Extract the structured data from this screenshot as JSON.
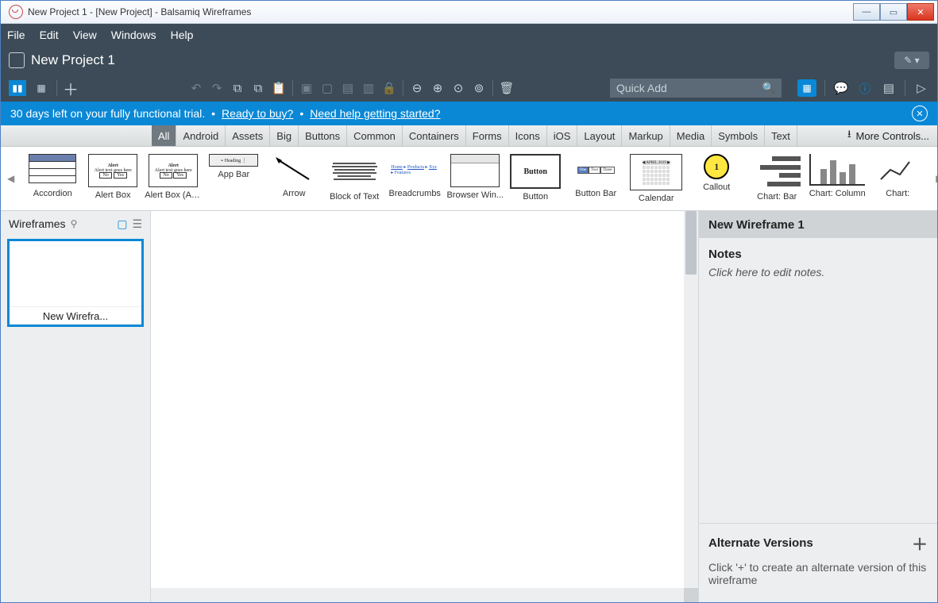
{
  "window_title": "New Project 1 - [New Project] - Balsamiq Wireframes",
  "menu": {
    "file": "File",
    "edit": "Edit",
    "view": "View",
    "windows": "Windows",
    "help": "Help"
  },
  "project_name": "New Project 1",
  "quick_add_placeholder": "Quick Add",
  "trial": {
    "text": "30 days left on your fully functional trial.",
    "ready": "Ready to buy?",
    "help": "Need help getting started?"
  },
  "categories": [
    "All",
    "Android",
    "Assets",
    "Big",
    "Buttons",
    "Common",
    "Containers",
    "Forms",
    "Icons",
    "iOS",
    "Layout",
    "Markup",
    "Media",
    "Symbols",
    "Text"
  ],
  "more_controls": "More Controls...",
  "library": [
    {
      "label": "Accordion",
      "type": "accordion"
    },
    {
      "label": "Alert Box",
      "type": "alert"
    },
    {
      "label": "Alert Box (An...",
      "type": "alert2"
    },
    {
      "label": "App Bar",
      "type": "appbar"
    },
    {
      "label": "Arrow",
      "type": "arrow"
    },
    {
      "label": "Block of Text",
      "type": "text"
    },
    {
      "label": "Breadcrumbs",
      "type": "bread"
    },
    {
      "label": "Browser Win...",
      "type": "browser"
    },
    {
      "label": "Button",
      "type": "button"
    },
    {
      "label": "Button Bar",
      "type": "bbar"
    },
    {
      "label": "Calendar",
      "type": "cal"
    },
    {
      "label": "Callout",
      "type": "callout"
    },
    {
      "label": "Chart: Bar",
      "type": "chartbar"
    },
    {
      "label": "Chart: Column",
      "type": "chartcol"
    },
    {
      "label": "Chart:",
      "type": "chartline"
    }
  ],
  "sidebar_title": "Wireframes",
  "thumb_name": "New Wirefra...",
  "right": {
    "title": "New Wireframe 1",
    "notes_label": "Notes",
    "notes_placeholder": "Click here to edit notes.",
    "alt_label": "Alternate Versions",
    "alt_text": "Click '+' to create an alternate version of this wireframe"
  }
}
